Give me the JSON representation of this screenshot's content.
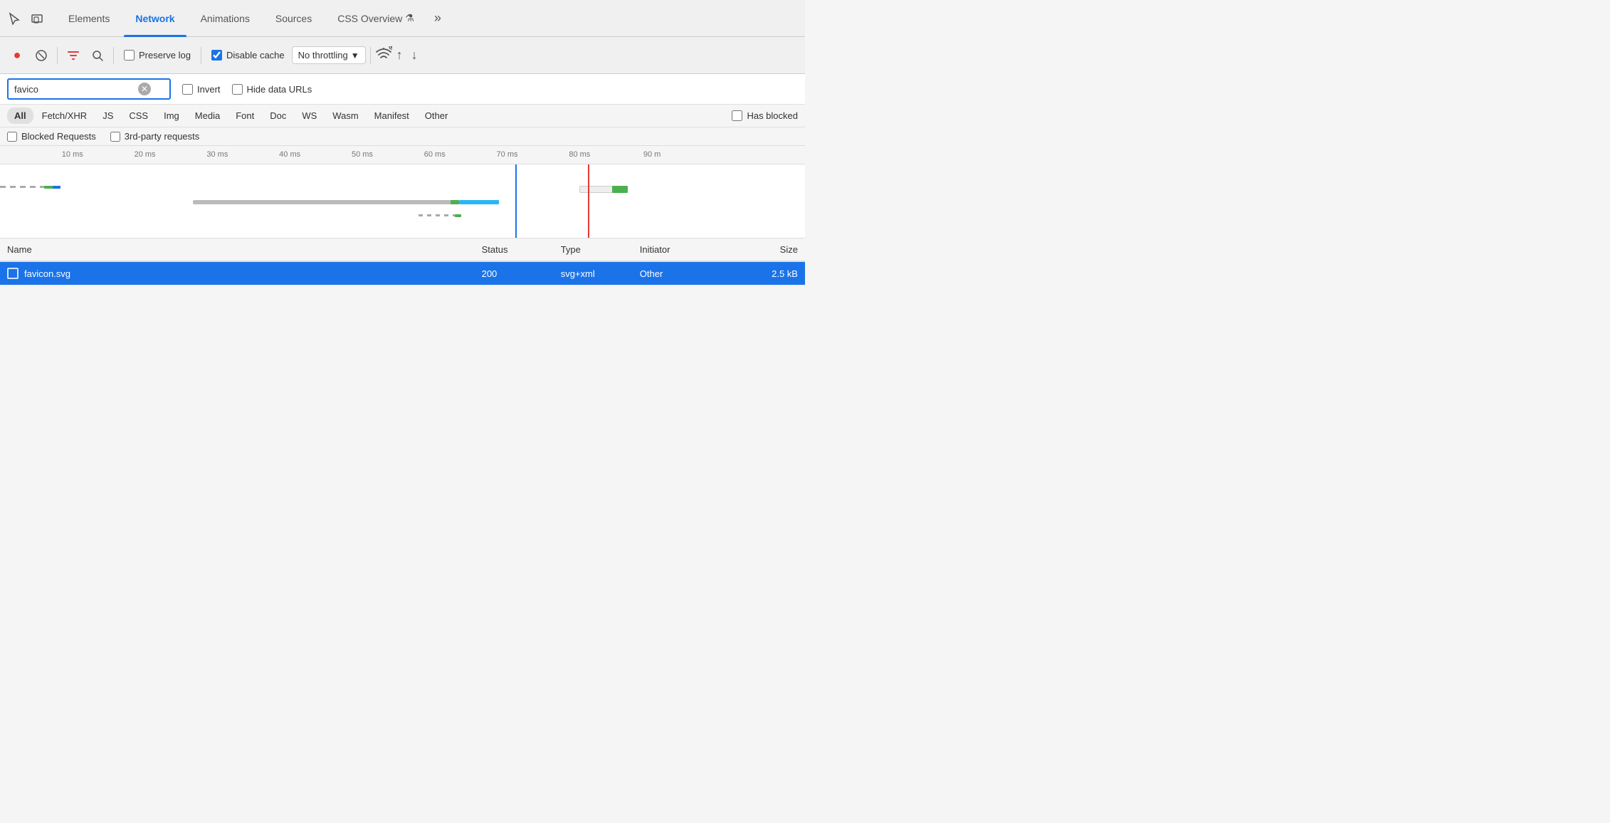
{
  "tabs": [
    {
      "id": "elements",
      "label": "Elements",
      "active": false
    },
    {
      "id": "network",
      "label": "Network",
      "active": true
    },
    {
      "id": "animations",
      "label": "Animations",
      "active": false
    },
    {
      "id": "sources",
      "label": "Sources",
      "active": false
    },
    {
      "id": "css-overview",
      "label": "CSS Overview",
      "active": false
    }
  ],
  "toolbar": {
    "preserve_log_label": "Preserve log",
    "disable_cache_label": "Disable cache",
    "throttle_label": "No throttling",
    "preserve_log_checked": false,
    "disable_cache_checked": true
  },
  "filter": {
    "search_value": "favico",
    "search_placeholder": "Filter",
    "invert_label": "Invert",
    "hide_data_urls_label": "Hide data URLs",
    "invert_checked": false,
    "hide_data_urls_checked": false
  },
  "type_filters": [
    {
      "id": "all",
      "label": "All",
      "active": true
    },
    {
      "id": "fetch-xhr",
      "label": "Fetch/XHR",
      "active": false
    },
    {
      "id": "js",
      "label": "JS",
      "active": false
    },
    {
      "id": "css",
      "label": "CSS",
      "active": false
    },
    {
      "id": "img",
      "label": "Img",
      "active": false
    },
    {
      "id": "media",
      "label": "Media",
      "active": false
    },
    {
      "id": "font",
      "label": "Font",
      "active": false
    },
    {
      "id": "doc",
      "label": "Doc",
      "active": false
    },
    {
      "id": "ws",
      "label": "WS",
      "active": false
    },
    {
      "id": "wasm",
      "label": "Wasm",
      "active": false
    },
    {
      "id": "manifest",
      "label": "Manifest",
      "active": false
    },
    {
      "id": "other",
      "label": "Other",
      "active": false
    }
  ],
  "has_blocked_label": "Has blocked",
  "extra_filters": {
    "blocked_requests_label": "Blocked Requests",
    "third_party_label": "3rd-party requests",
    "blocked_checked": false,
    "third_party_checked": false
  },
  "timeline": {
    "ticks": [
      {
        "label": "10 ms",
        "pct": 9
      },
      {
        "label": "20 ms",
        "pct": 18
      },
      {
        "label": "30 ms",
        "pct": 27
      },
      {
        "label": "40 ms",
        "pct": 36
      },
      {
        "label": "50 ms",
        "pct": 45
      },
      {
        "label": "60 ms",
        "pct": 54
      },
      {
        "label": "70 ms",
        "pct": 63
      },
      {
        "label": "80 ms",
        "pct": 72
      },
      {
        "label": "90 m",
        "pct": 81
      }
    ],
    "blue_line_pct": 64,
    "red_line_pct": 73
  },
  "table": {
    "columns": {
      "name": "Name",
      "status": "Status",
      "type": "Type",
      "initiator": "Initiator",
      "size": "Size"
    },
    "rows": [
      {
        "name": "favicon.svg",
        "status": "200",
        "type": "svg+xml",
        "initiator": "Other",
        "size": "2.5 kB",
        "selected": true
      }
    ]
  }
}
